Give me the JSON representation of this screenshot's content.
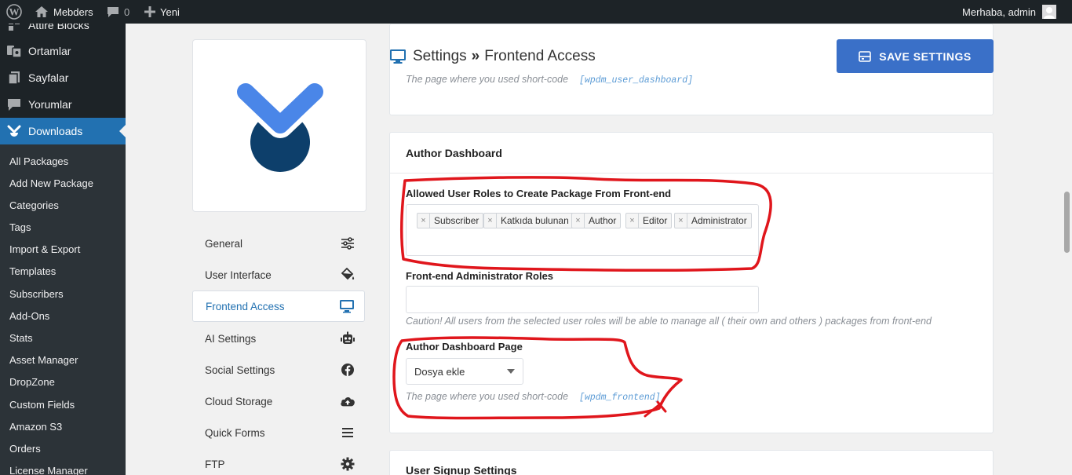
{
  "admin_bar": {
    "site_name": "Mebders",
    "comments_count": "0",
    "new_label": "Yeni",
    "greeting": "Merhaba, admin"
  },
  "sidebar": {
    "top_items": [
      {
        "label": "Attire Blocks",
        "icon": "blocks-icon"
      },
      {
        "label": "Ortamlar",
        "icon": "media-icon"
      },
      {
        "label": "Sayfalar",
        "icon": "pages-icon"
      },
      {
        "label": "Yorumlar",
        "icon": "comments-icon"
      },
      {
        "label": "Downloads",
        "icon": "downloads-icon"
      }
    ],
    "submenu": [
      "All Packages",
      "Add New Package",
      "Categories",
      "Tags",
      "Import & Export",
      "Templates",
      "Subscribers",
      "Add-Ons",
      "Stats",
      "Asset Manager",
      "DropZone",
      "Custom Fields",
      "Amazon S3",
      "Orders",
      "License Manager"
    ]
  },
  "settings_nav": [
    {
      "label": "General",
      "icon": "sliders-icon"
    },
    {
      "label": "User Interface",
      "icon": "paint-bucket-icon"
    },
    {
      "label": "Frontend Access",
      "icon": "monitor-icon"
    },
    {
      "label": "AI Settings",
      "icon": "robot-icon"
    },
    {
      "label": "Social Settings",
      "icon": "facebook-icon"
    },
    {
      "label": "Cloud Storage",
      "icon": "cloud-upload-icon"
    },
    {
      "label": "Quick Forms",
      "icon": "menu-icon"
    },
    {
      "label": "FTP",
      "icon": "gear-icon"
    }
  ],
  "header": {
    "title": "Settings",
    "separator": "»",
    "subtitle": "Frontend Access",
    "save_label": "SAVE SETTINGS"
  },
  "top_card": {
    "hint": "The page where you used short-code",
    "code": "[wpdm_user_dashboard]"
  },
  "author_dashboard": {
    "title": "Author Dashboard",
    "roles_label": "Allowed User Roles to Create Package From Front-end",
    "roles_tags": [
      "Subscriber",
      "Katkıda bulunan",
      "Author",
      "Editor",
      "Administrator"
    ],
    "admin_roles_label": "Front-end Administrator Roles",
    "admin_roles_caution": "Caution! All users from the selected user roles will be able to manage all ( their own and others ) packages from front-end",
    "page_label": "Author Dashboard Page",
    "page_selected": "Dosya ekle",
    "page_hint": "The page where you used short-code",
    "page_code": "[wpdm_frontend]"
  },
  "signup_card": {
    "title": "User Signup Settings"
  },
  "colors": {
    "admin_dark": "#1d2327",
    "wp_blue": "#2271b1",
    "save_button": "#3a70c8",
    "annotation_red": "#e0161c",
    "logo_blue": "#4a86e8",
    "logo_navy": "#0d3f6b"
  }
}
